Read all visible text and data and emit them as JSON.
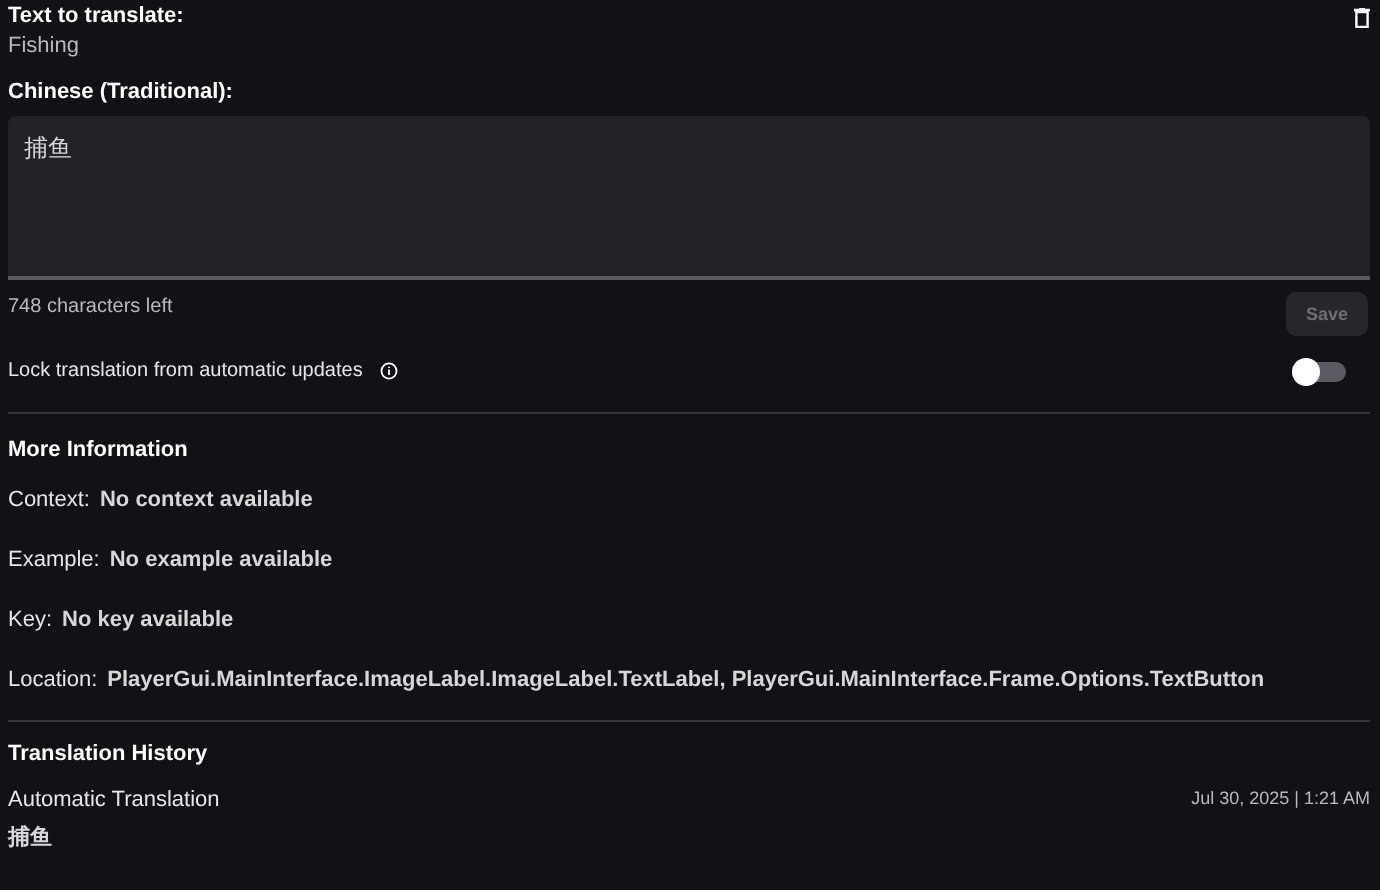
{
  "source": {
    "label": "Text to translate:",
    "text": "Fishing"
  },
  "target": {
    "label": "Chinese (Traditional):",
    "value": "捕鱼",
    "characters_left": "748 characters left"
  },
  "save_button": {
    "label": "Save",
    "disabled": true
  },
  "lock": {
    "label": "Lock translation from automatic updates",
    "on": false
  },
  "more_information": {
    "title": "More Information",
    "fields": [
      {
        "label": "Context:",
        "value": "No context available"
      },
      {
        "label": "Example:",
        "value": "No example available"
      },
      {
        "label": "Key:",
        "value": "No key available"
      },
      {
        "label": "Location:",
        "value": "PlayerGui.MainInterface.ImageLabel.ImageLabel.TextLabel, PlayerGui.MainInterface.Frame.Options.TextButton"
      }
    ]
  },
  "translation_history": {
    "title": "Translation History",
    "entries": [
      {
        "source": "Automatic Translation",
        "timestamp": "Jul 30, 2025 | 1:21 AM",
        "text": "捕鱼"
      }
    ]
  }
}
